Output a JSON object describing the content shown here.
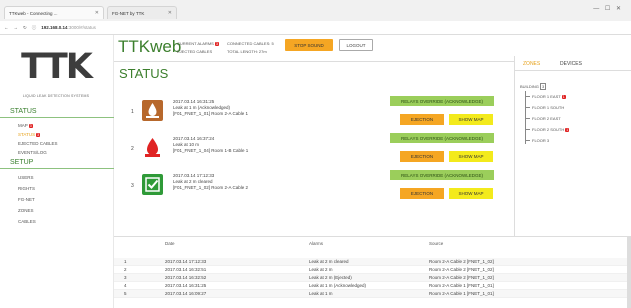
{
  "browser": {
    "tabs": [
      {
        "title": "TTKweb - Connecting ..."
      },
      {
        "title": "FG-NET by TTK"
      }
    ],
    "url": "192.168.0.14:3000/#/status",
    "url_host": "192.168.0.14",
    "url_path": ":3000/#/status"
  },
  "sidebar": {
    "logo": "TTK",
    "logo_sub": "LIQUID LEAK DETECTION SYSTEMS",
    "status_heading": "STATUS",
    "status_items": [
      {
        "label": "MAP",
        "badge": "3"
      },
      {
        "label": "STATUS",
        "badge": "3"
      },
      {
        "label": "EJECTED CABLES",
        "badge": ""
      },
      {
        "label": "EVENTS/LOG",
        "badge": ""
      }
    ],
    "setup_heading": "SETUP",
    "setup_items": [
      {
        "label": "USERS"
      },
      {
        "label": "RIGHTS"
      },
      {
        "label": "FG-NET"
      },
      {
        "label": "ZONES"
      },
      {
        "label": "CABLES"
      }
    ]
  },
  "header": {
    "brand": "TTKweb",
    "current_alarms_label": "CURRENT ALARMS",
    "current_alarms_count": "3",
    "connected_cables_label": "CONNECTED CABLES: 5",
    "ejected_cables_label": "EJECTED CABLES",
    "total_length_label": "TOTAL LENGTH: 27m",
    "stop_sound": "STOP SOUND",
    "logout": "LOGOUT"
  },
  "main": {
    "title": "STATUS",
    "alarms": [
      {
        "num": "1",
        "date": "2017.03.14 16:31:25",
        "message": "Leak at 1 m (Acknowledged)",
        "source": "[F01_FNET_1_01] Room 2-A Cable 1",
        "relay": "RELAYS OVERRIDE (ACKNOWLEDGE)",
        "eject": "EJECTION",
        "map": "SHOW MAP"
      },
      {
        "num": "2",
        "date": "2017.03.14 16:37:24",
        "message": "Leak at 10 m",
        "source": "[F01_FNET_1_04] Room 1-B Cable 1",
        "relay": "RELAYS OVERRIDE (ACKNOWLEDGE)",
        "eject": "EJECTION",
        "map": "SHOW MAP"
      },
      {
        "num": "3",
        "date": "2017.03.14 17:12:33",
        "message": "Leak at 2 m cleared",
        "source": "[F01_FNET_1_02] Room 2-A Cable 2",
        "relay": "RELAYS OVERRIDE (ACKNOWLEDGE)",
        "eject": "EJECTION",
        "map": "SHOW MAP"
      }
    ]
  },
  "zones": {
    "tab_zones": "ZONES",
    "tab_devices": "DEVICES",
    "root": "BUILDING",
    "root_badge": "3",
    "floors": [
      {
        "label": "FLOOR 1 EAST",
        "badge": "1"
      },
      {
        "label": "FLOOR 1 SOUTH",
        "badge": ""
      },
      {
        "label": "FLOOR 2 EAST",
        "badge": ""
      },
      {
        "label": "FLOOR 2 SOUTH",
        "badge": "1"
      },
      {
        "label": "FLOOR 3",
        "badge": ""
      }
    ]
  },
  "log": {
    "col_date": "Date",
    "col_alarms": "Alarms",
    "col_source": "Source",
    "rows": [
      {
        "n": "1",
        "date": "2017.03.14 17:12:33",
        "alarm": "Leak at 2 m cleared",
        "source": "Room 2-A Cable 2 [FNET_1_02]"
      },
      {
        "n": "2",
        "date": "2017.03.14 16:32:51",
        "alarm": "Leak at 2 m",
        "source": "Room 2-A Cable 2 [FNET_1_02]"
      },
      {
        "n": "3",
        "date": "2017.03.14 16:32:52",
        "alarm": "Leak at 2 m (Ejected)",
        "source": "Room 2-A Cable 2 [FNET_1_02]"
      },
      {
        "n": "4",
        "date": "2017.03.14 16:31:25",
        "alarm": "Leak at 1 m (Acknowledged)",
        "source": "Room 2-A Cable 1 [FNET_1_01]"
      },
      {
        "n": "5",
        "date": "2017.03.14 16:09:27",
        "alarm": "Leak at 1 m",
        "source": "Room 2-A Cable 1 [FNET_1_01]"
      }
    ]
  },
  "colors": {
    "brand_green": "#3c7f2d",
    "relay_green": "#9bce5b",
    "eject_orange": "#f5a623",
    "map_yellow": "#f3ea1c",
    "alarm_red": "#e02323",
    "leak_orange_icon": "#b7682c",
    "ok_green_icon": "#2f9a38"
  }
}
